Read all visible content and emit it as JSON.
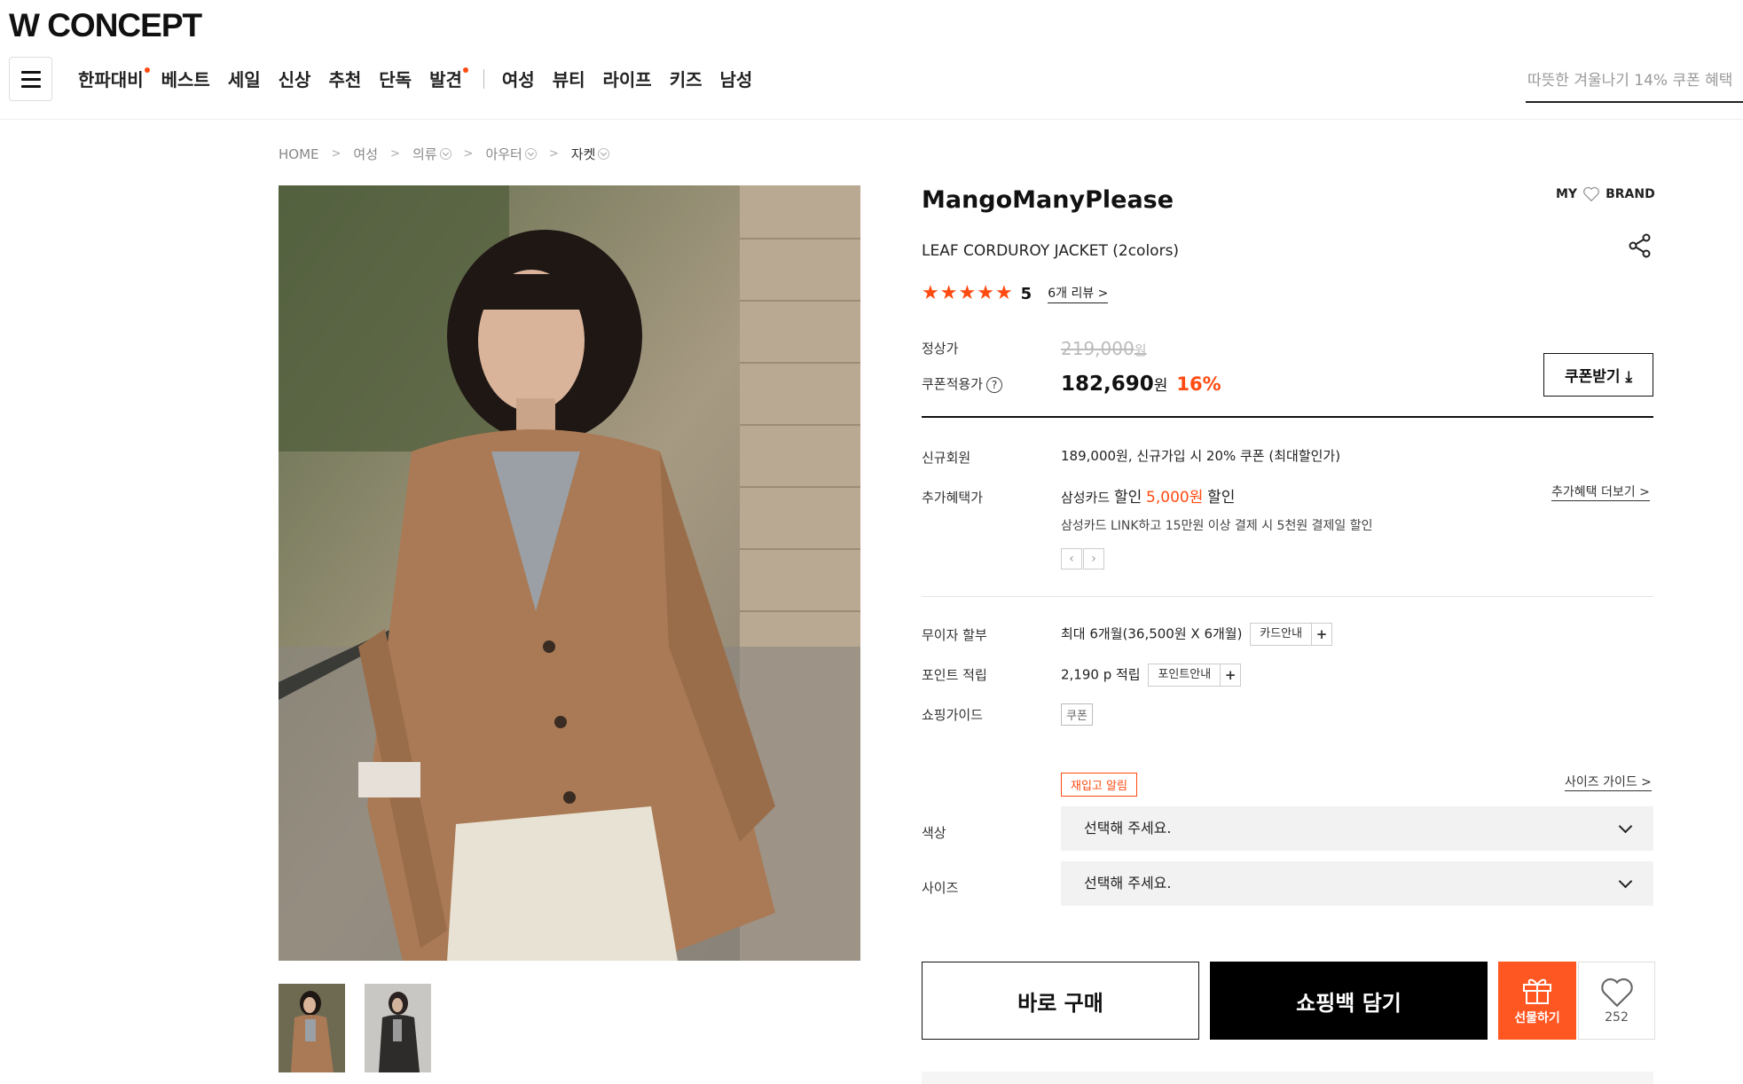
{
  "header": {
    "logo": "W CONCEPT",
    "nav_left": [
      "한파대비",
      "베스트",
      "세일",
      "신상",
      "추천",
      "단독",
      "발견"
    ],
    "nav_right": [
      "여성",
      "뷰티",
      "라이프",
      "키즈",
      "남성"
    ],
    "search_placeholder": "따뜻한 겨울나기 14% 쿠폰 혜택"
  },
  "breadcrumb": [
    "HOME",
    "여성",
    "의류",
    "아우터",
    "자켓"
  ],
  "product": {
    "brand": "MangoManyPlease",
    "my_brand_my": "MY",
    "my_brand_brand": "BRAND",
    "name": "LEAF CORDUROY JACKET (2colors)",
    "rating_stars": 5,
    "rating": "5",
    "review_count": "6",
    "review_suffix": "개 리뷰",
    "regular_price_label": "정상가",
    "regular_price": "219,000",
    "coupon_price_label": "쿠폰적용가",
    "coupon_price": "182,690",
    "won": "원",
    "discount": "16%",
    "coupon_button": "쿠폰받기"
  },
  "benefits": {
    "new_member_label": "신규회원",
    "new_member_value": "189,000원, 신규가입 시 20% 쿠폰 (최대할인가)",
    "extra_label": "추가혜택가",
    "extra_card": "삼성카드",
    "extra_discount_word": "할인",
    "extra_amount": "5,000원",
    "extra_discount_word2": "할인",
    "extra_note": "삼성카드 LINK하고 15만원 이상 결제 시 5천원 결제일 할인",
    "extra_more": "추가혜택 더보기",
    "installment_label": "무이자 할부",
    "installment_value": "최대 6개월(36,500원 X 6개월)",
    "installment_btn": "카드안내",
    "points_label": "포인트 적립",
    "points_value": "2,190 p 적립",
    "points_btn": "포인트안내",
    "guide_label": "쇼핑가이드",
    "guide_tag": "쿠폰"
  },
  "options": {
    "restock": "재입고 알림",
    "size_guide": "사이즈 가이드",
    "color_label": "색상",
    "color_placeholder": "선택해 주세요.",
    "size_label": "사이즈",
    "size_placeholder": "선택해 주세요."
  },
  "actions": {
    "buy_now": "바로 구매",
    "add_to_bag": "쇼핑백 담기",
    "gift": "선물하기",
    "like_count": "252"
  },
  "colors": {
    "accent": "#ff4b12",
    "black": "#000000"
  }
}
